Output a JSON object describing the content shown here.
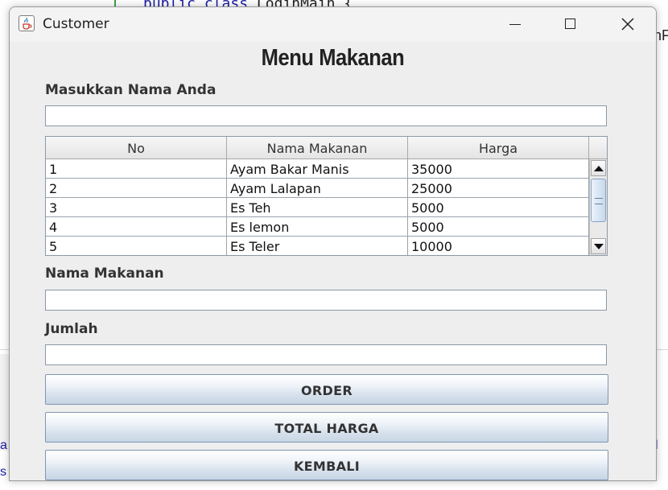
{
  "background": {
    "code_line_keyword": "public class",
    "code_line_class": "LoginMain {",
    "right_fragment": "nF",
    "left_fragment_1": "a",
    "left_fragment_2": "s",
    "right_fragment_2": "l"
  },
  "window": {
    "title": "Customer",
    "icon": "java-cup-icon"
  },
  "heading": "Menu Makanan",
  "form": {
    "name_label": "Masukkan Nama Anda",
    "name_value": "",
    "food_label": "Nama Makanan",
    "food_value": "",
    "qty_label": "Jumlah",
    "qty_value": ""
  },
  "table": {
    "columns": [
      "No",
      "Nama Makanan",
      "Harga"
    ],
    "rows": [
      [
        "1",
        "Ayam Bakar Manis",
        "35000"
      ],
      [
        "2",
        "Ayam Lalapan",
        "25000"
      ],
      [
        "3",
        "Es Teh",
        "5000"
      ],
      [
        "4",
        "Es lemon",
        "5000"
      ],
      [
        "5",
        "Es Teler",
        "10000"
      ]
    ]
  },
  "buttons": {
    "order": "ORDER",
    "total": "TOTAL HARGA",
    "back": "KEMBALI"
  }
}
